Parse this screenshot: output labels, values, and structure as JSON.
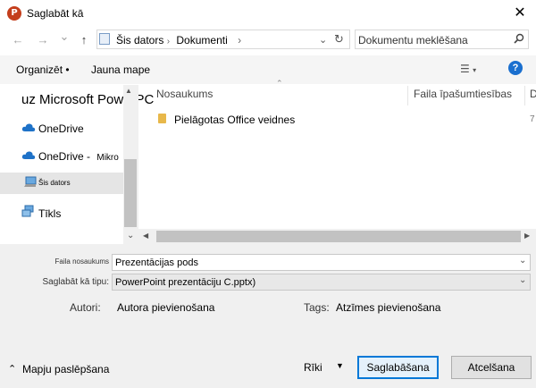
{
  "window": {
    "title": "Saglabāt kā",
    "close_symbol": "✕"
  },
  "nav": {
    "back_symbol": "←",
    "forward_symbol": "→",
    "dropdown_symbol": "⌄",
    "up_symbol": "↑",
    "refresh_symbol": "↻",
    "breadcrumb": [
      "Šis dators",
      "Dokumenti"
    ],
    "separator": "›",
    "search_placeholder": "Dokumentu meklēšana"
  },
  "toolbar": {
    "organize": "Organizēt •",
    "new_folder": "Jauna mape",
    "help": "?"
  },
  "sidebar": {
    "items": [
      {
        "label": "uz Microsoft PowerPC",
        "icon": "none"
      },
      {
        "label": "OneDrive",
        "icon": "cloud-icon"
      },
      {
        "label": "OneDrive -",
        "suffix": "Mikro",
        "icon": "cloud-icon"
      },
      {
        "label": "Šis dators",
        "icon": "computer-icon",
        "selected": true
      },
      {
        "label": "Tīkls",
        "icon": "network-icon"
      }
    ]
  },
  "file_list": {
    "columns": [
      "Nosaukums",
      "Faila īpašumtiesības",
      "D"
    ],
    "rows": [
      {
        "name": "Pielāgotas Office veidnes",
        "extra": "7"
      }
    ]
  },
  "form": {
    "filename_label": "Faila nosaukums",
    "filename_value": "Prezentācijas pods",
    "type_label": "Saglabāt kā tipu:",
    "type_value": "PowerPoint prezentāciju C.pptx)",
    "authors_label": "Autori:",
    "authors_value": "Autora pievienošana",
    "tags_label": "Tags:",
    "tags_value": "Atzīmes pievienošana"
  },
  "footer": {
    "hide_folders": "Mapju paslēpšana",
    "tools": "Rīki",
    "save": "Saglabāšana",
    "cancel": "Atcelšana"
  }
}
